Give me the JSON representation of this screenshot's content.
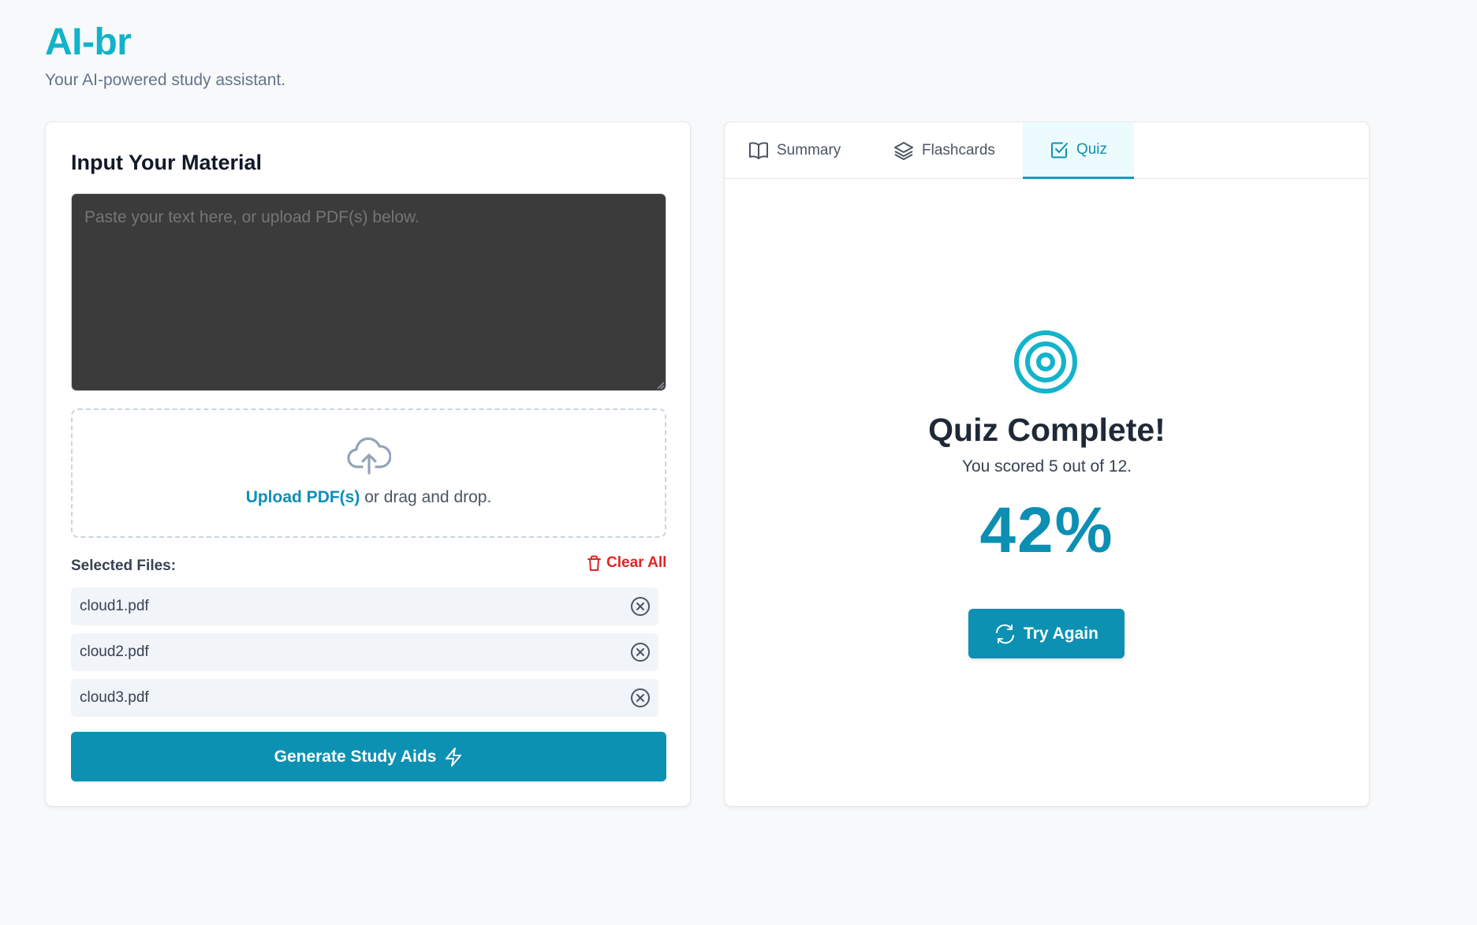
{
  "app": {
    "title": "AI-br",
    "subtitle": "Your AI-powered study assistant."
  },
  "input": {
    "section_title": "Input Your Material",
    "textarea_placeholder": "Paste your text here, or upload PDF(s) below.",
    "textarea_value": "",
    "upload_link": "Upload PDF(s)",
    "upload_suffix": " or drag and drop.",
    "files_label": "Selected Files:",
    "clear_all_label": "Clear All",
    "files": [
      {
        "name": "cloud1.pdf"
      },
      {
        "name": "cloud2.pdf"
      },
      {
        "name": "cloud3.pdf"
      }
    ],
    "generate_label": "Generate Study Aids"
  },
  "tabs": [
    {
      "label": "Summary",
      "icon": "book-open-icon",
      "active": false
    },
    {
      "label": "Flashcards",
      "icon": "layers-icon",
      "active": false
    },
    {
      "label": "Quiz",
      "icon": "check-square-icon",
      "active": true
    }
  ],
  "quiz_result": {
    "icon": "target-icon",
    "title": "Quiz Complete!",
    "score_text": "You scored 5 out of 12.",
    "percent": "42%",
    "try_again_label": "Try Again"
  },
  "colors": {
    "brand": "#12b3c9",
    "primary_button": "#0c91b3",
    "danger": "#dc2626",
    "textarea_bg": "#3b3b3b",
    "page_bg": "#f8f9fb"
  }
}
